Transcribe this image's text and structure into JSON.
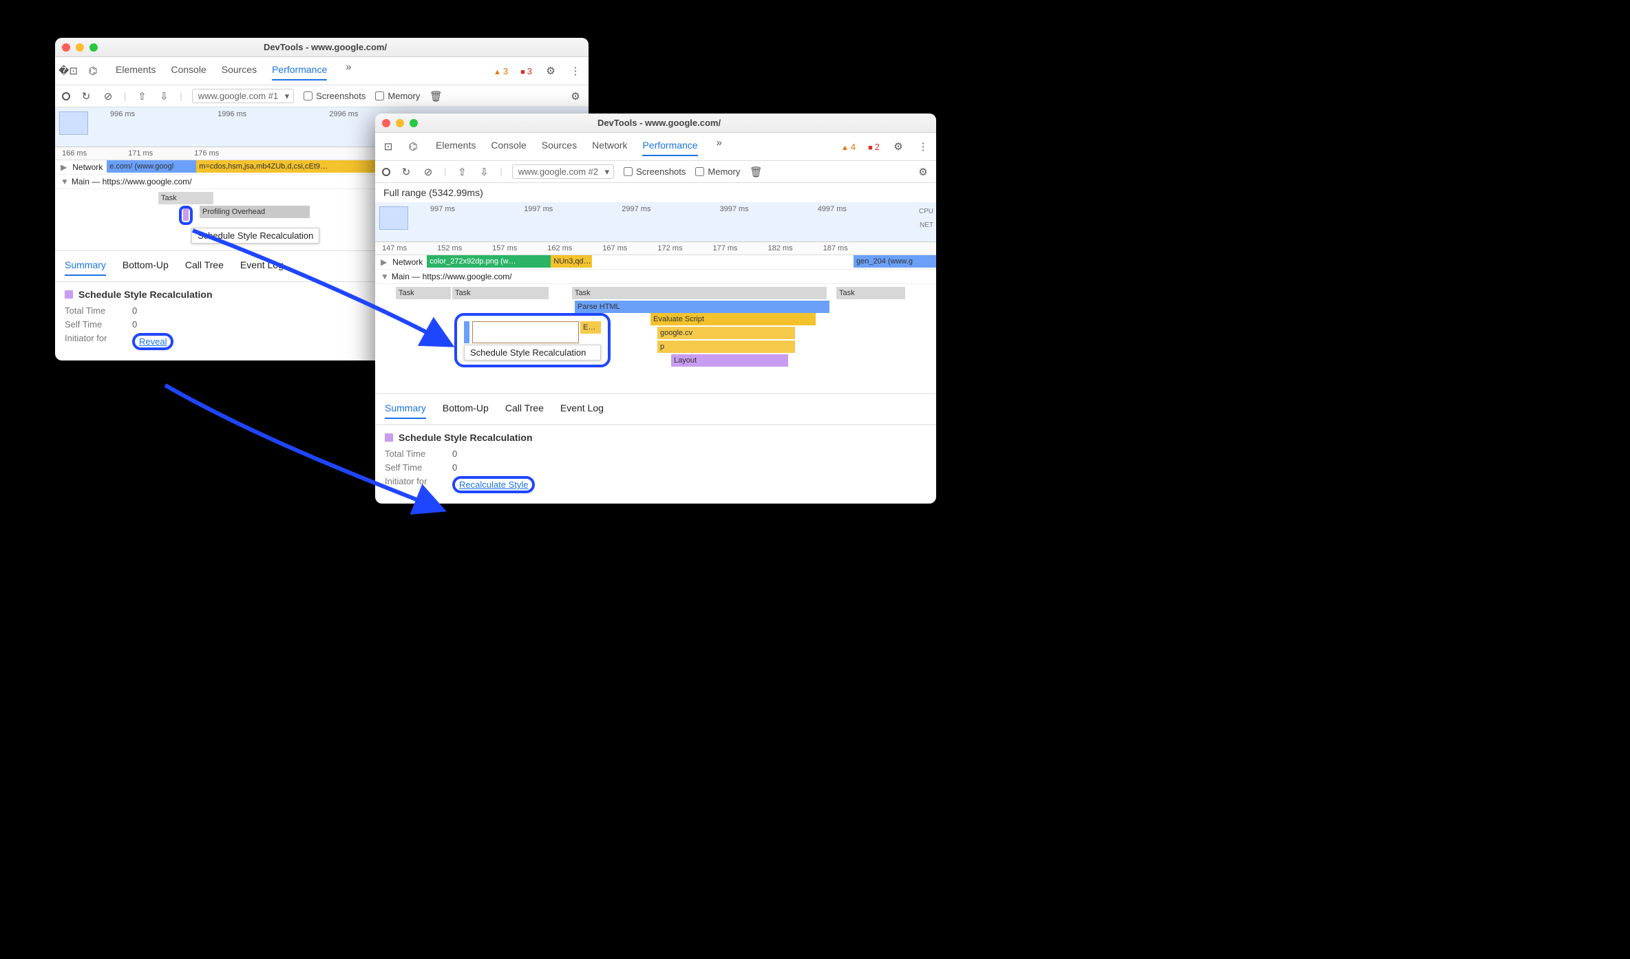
{
  "w1": {
    "title": "DevTools - www.google.com/",
    "tabs": [
      "Elements",
      "Console",
      "Sources",
      "Performance"
    ],
    "active_tab": "Performance",
    "warn_count": "3",
    "issue_count": "3",
    "recording": "www.google.com #1",
    "cb_screenshots": "Screenshots",
    "cb_memory": "Memory",
    "ov_times": [
      "996 ms",
      "1996 ms",
      "2996 ms"
    ],
    "ruler": [
      "166 ms",
      "171 ms",
      "176 ms"
    ],
    "network_label": "Network",
    "network_seg1": "e.com/ (www.googl",
    "network_seg2": "m=cdos,hsm,jsa,mb4ZUb,d,csi,cEt9…",
    "main_label": "Main — https://www.google.com/",
    "task": "Task",
    "prof": "Profiling Overhead",
    "schedule": "Schedule Style Recalculation",
    "panel_tabs": [
      "Summary",
      "Bottom-Up",
      "Call Tree",
      "Event Log"
    ],
    "panel_active": "Summary",
    "panel_title": "Schedule Style Recalculation",
    "total_time_k": "Total Time",
    "total_time_v": "0",
    "self_time_k": "Self Time",
    "self_time_v": "0",
    "initiator_k": "Initiator for",
    "initiator_link": "Reveal"
  },
  "w2": {
    "title": "DevTools - www.google.com/",
    "tabs": [
      "Elements",
      "Console",
      "Sources",
      "Network",
      "Performance"
    ],
    "active_tab": "Performance",
    "warn_count": "4",
    "err_count": "2",
    "recording": "www.google.com #2",
    "cb_screenshots": "Screenshots",
    "cb_memory": "Memory",
    "range": "Full range (5342.99ms)",
    "ov_times": [
      "997 ms",
      "1997 ms",
      "2997 ms",
      "3997 ms",
      "4997 ms"
    ],
    "ov_cpu": "CPU",
    "ov_net": "NET",
    "ruler": [
      "147 ms",
      "152 ms",
      "157 ms",
      "162 ms",
      "167 ms",
      "172 ms",
      "177 ms",
      "182 ms",
      "187 ms"
    ],
    "network_label": "Network",
    "net_seg1": "color_272x92dp.png (w…",
    "net_seg2": "NUn3,qd…",
    "net_seg3": "gen_204 (www.g",
    "main_label": "Main — https://www.google.com/",
    "task": "Task",
    "parse": "Parse HTML",
    "e": "E…",
    "eval": "Evaluate Script",
    "gcv": "google.cv",
    "p": "p",
    "layout": "Layout",
    "tooltip": "Schedule Style Recalculation",
    "panel_tabs": [
      "Summary",
      "Bottom-Up",
      "Call Tree",
      "Event Log"
    ],
    "panel_active": "Summary",
    "panel_title": "Schedule Style Recalculation",
    "total_time_k": "Total Time",
    "total_time_v": "0",
    "self_time_k": "Self Time",
    "self_time_v": "0",
    "initiator_k": "Initiator for",
    "initiator_link": "Recalculate Style"
  },
  "icons": {
    "gear": "⚙",
    "more": "⋮",
    "chev": "»",
    "reload": "↻",
    "block": "⊘",
    "upload": "⇧",
    "download": "⇩",
    "trash": "🗑",
    "device": "⌬"
  }
}
